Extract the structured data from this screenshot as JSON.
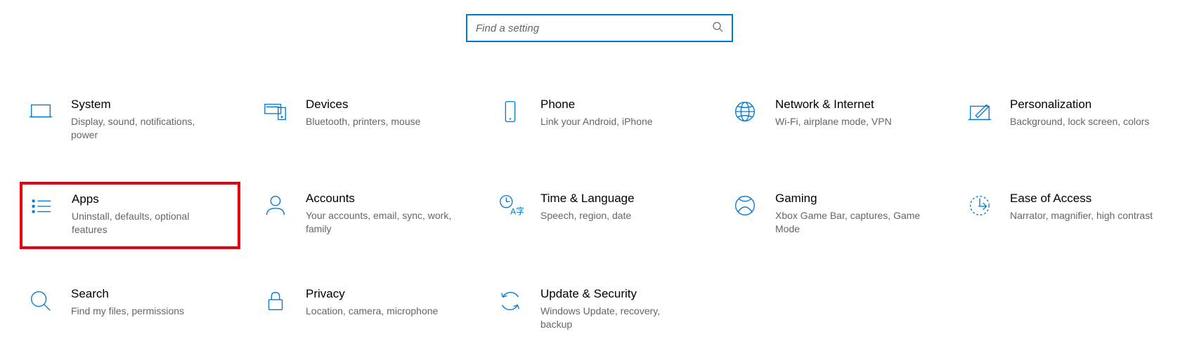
{
  "search": {
    "placeholder": "Find a setting"
  },
  "categories": [
    {
      "key": "system",
      "title": "System",
      "desc": "Display, sound, notifications, power",
      "highlighted": false
    },
    {
      "key": "devices",
      "title": "Devices",
      "desc": "Bluetooth, printers, mouse",
      "highlighted": false
    },
    {
      "key": "phone",
      "title": "Phone",
      "desc": "Link your Android, iPhone",
      "highlighted": false
    },
    {
      "key": "network",
      "title": "Network & Internet",
      "desc": "Wi-Fi, airplane mode, VPN",
      "highlighted": false
    },
    {
      "key": "personalization",
      "title": "Personalization",
      "desc": "Background, lock screen, colors",
      "highlighted": false
    },
    {
      "key": "apps",
      "title": "Apps",
      "desc": "Uninstall, defaults, optional features",
      "highlighted": true
    },
    {
      "key": "accounts",
      "title": "Accounts",
      "desc": "Your accounts, email, sync, work, family",
      "highlighted": false
    },
    {
      "key": "time",
      "title": "Time & Language",
      "desc": "Speech, region, date",
      "highlighted": false
    },
    {
      "key": "gaming",
      "title": "Gaming",
      "desc": "Xbox Game Bar, captures, Game Mode",
      "highlighted": false
    },
    {
      "key": "ease",
      "title": "Ease of Access",
      "desc": "Narrator, magnifier, high contrast",
      "highlighted": false
    },
    {
      "key": "search",
      "title": "Search",
      "desc": "Find my files, permissions",
      "highlighted": false
    },
    {
      "key": "privacy",
      "title": "Privacy",
      "desc": "Location, camera, microphone",
      "highlighted": false
    },
    {
      "key": "update",
      "title": "Update & Security",
      "desc": "Windows Update, recovery, backup",
      "highlighted": false
    }
  ]
}
